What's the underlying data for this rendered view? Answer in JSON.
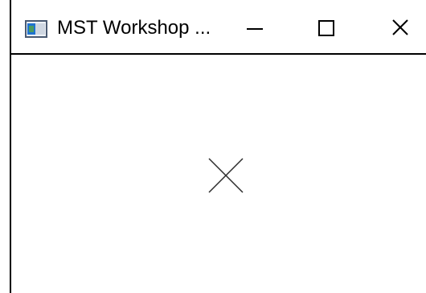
{
  "window": {
    "title": "MST Workshop ...",
    "minimize_icon": "minimize-icon",
    "maximize_icon": "maximize-icon",
    "close_icon": "close-icon",
    "app_icon": "app-window-icon"
  },
  "content": {
    "placeholder_icon": "cross-placeholder-icon"
  },
  "colors": {
    "background": "#ffffff",
    "border": "#000000",
    "text": "#000000",
    "placeholder_stroke": "#2b2b2b"
  }
}
